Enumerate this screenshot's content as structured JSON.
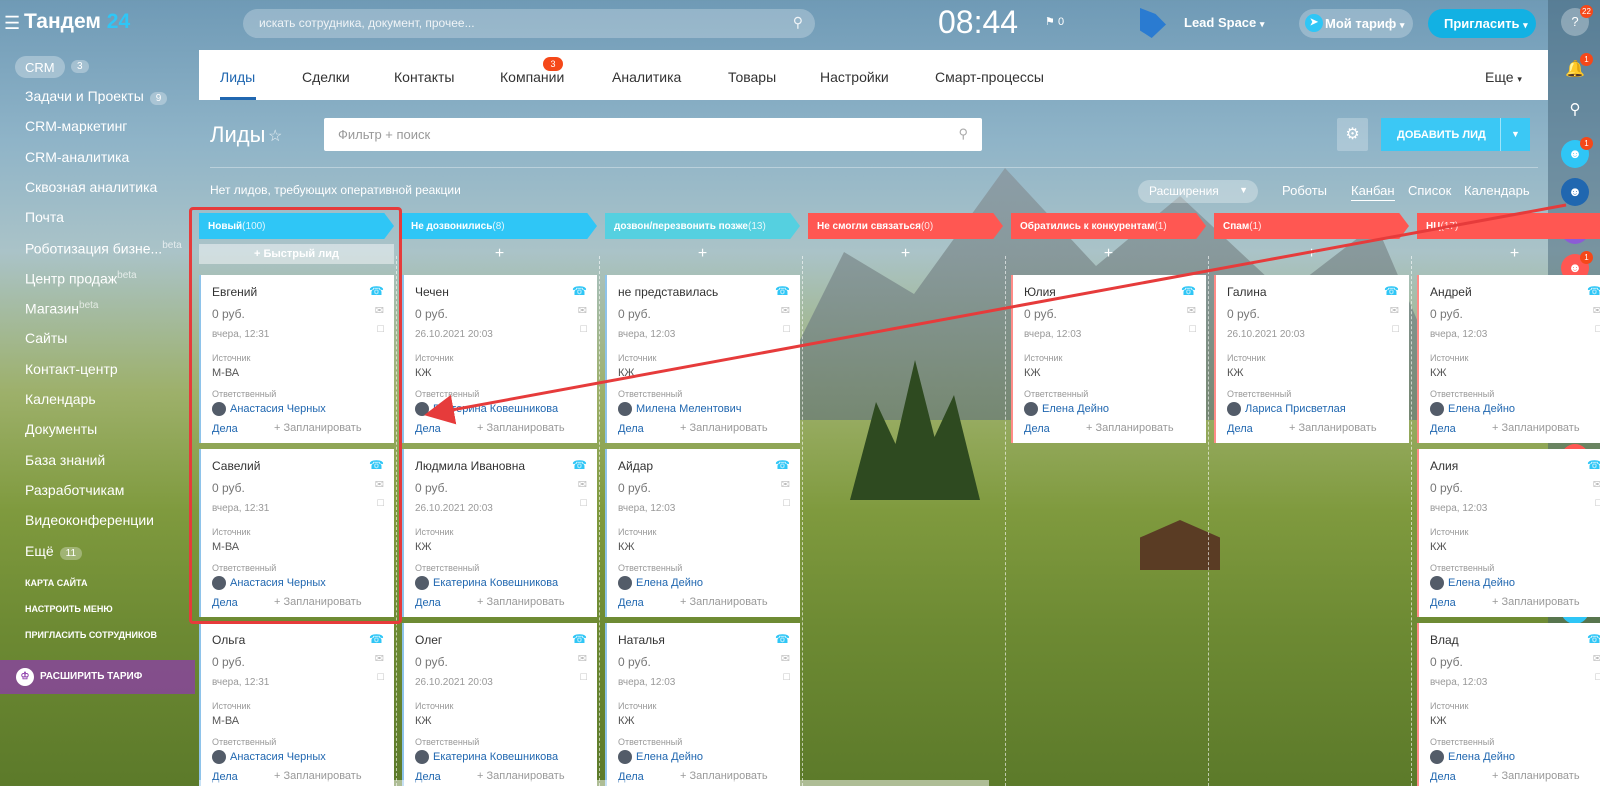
{
  "topbar": {
    "logo_main": "Тандем",
    "logo_num": "24",
    "search_placeholder": "искать сотрудника, документ, прочее...",
    "clock": "08:44",
    "flag_count": "0",
    "workspace": "Lead Space",
    "tariff": "Мой тариф",
    "invite": "Пригласить"
  },
  "rightbar": {
    "help_badge": "22",
    "items": [
      {
        "badge": "1"
      },
      {
        "badge": ""
      },
      {
        "badge": ""
      },
      {
        "badge": "1"
      },
      {
        "badge": "1"
      },
      {
        "badge": "1"
      },
      {
        "badge": "1"
      },
      {
        "badge": "1"
      },
      {
        "badge": ""
      },
      {
        "badge": ""
      },
      {
        "badge": "1"
      },
      {
        "badge": ""
      },
      {
        "badge": ""
      },
      {
        "badge": ""
      },
      {
        "badge": ""
      },
      {
        "badge": ""
      }
    ]
  },
  "sidebar": {
    "crm": "CRM",
    "crm_count": "3",
    "items": [
      {
        "label": "Задачи и Проекты",
        "count": "9"
      },
      {
        "label": "CRM-маркетинг"
      },
      {
        "label": "CRM-аналитика"
      },
      {
        "label": "Сквозная аналитика"
      },
      {
        "label": "Почта"
      },
      {
        "label": "Роботизация бизне...",
        "beta": "beta"
      },
      {
        "label": "Центр продаж",
        "beta": "beta"
      },
      {
        "label": "Магазин",
        "beta": "beta"
      },
      {
        "label": "Сайты"
      },
      {
        "label": "Контакт-центр"
      },
      {
        "label": "Календарь"
      },
      {
        "label": "Документы"
      },
      {
        "label": "База знаний"
      },
      {
        "label": "Разработчикам"
      },
      {
        "label": "Видеоконференции"
      },
      {
        "label": "Ещё",
        "count": "11"
      }
    ],
    "site_map": "КАРТА САЙТА",
    "setup_menu": "НАСТРОИТЬ МЕНЮ",
    "invite_staff": "ПРИГЛАСИТЬ СОТРУДНИКОВ",
    "upgrade": "РАСШИРИТЬ ТАРИФ"
  },
  "tabs": {
    "items": [
      "Лиды",
      "Сделки",
      "Контакты",
      "Компании",
      "Аналитика",
      "Товары",
      "Настройки",
      "Смарт-процессы"
    ],
    "deals_badge": "3",
    "more": "Еще"
  },
  "page": {
    "title": "Лиды",
    "filter_placeholder": "Фильтр + поиск",
    "add_lead": "ДОБАВИТЬ ЛИД",
    "notice": "Нет лидов, требующих оперативной реакции",
    "extensions": "Расширения",
    "views": [
      "Роботы",
      "Канбан",
      "Список",
      "Календарь"
    ]
  },
  "labels": {
    "source": "Источник",
    "responsible": "Ответственный",
    "deals": "Дела",
    "plan": "+ Запланировать",
    "quick_lead": "Быстрый лид",
    "add": "+"
  },
  "columns": [
    {
      "title": "Новый",
      "count": "(100)",
      "color": "#2fc6f6",
      "cards": [
        {
          "name": "Евгений",
          "sum": "0 руб.",
          "date": "вчера, 12:31",
          "source": "М-ВА",
          "resp": "Анастасия Черных"
        },
        {
          "name": "Савелий",
          "sum": "0 руб.",
          "date": "вчера, 12:31",
          "source": "М-ВА",
          "resp": "Анастасия Черных"
        },
        {
          "name": "Ольга",
          "sum": "0 руб.",
          "date": "вчера, 12:31",
          "source": "М-ВА",
          "resp": "Анастасия Черных"
        }
      ]
    },
    {
      "title": "Не дозвонились",
      "count": "(8)",
      "color": "#2fc6f6",
      "cards": [
        {
          "name": "Чечен",
          "sum": "0 руб.",
          "date": "26.10.2021 20:03",
          "source": "КЖ",
          "resp": "Екатерина Ковешникова"
        },
        {
          "name": "Людмила Ивановна",
          "sum": "0 руб.",
          "date": "26.10.2021 20:03",
          "source": "КЖ",
          "resp": "Екатерина Ковешникова"
        },
        {
          "name": "Олег",
          "sum": "0 руб.",
          "date": "26.10.2021 20:03",
          "source": "КЖ",
          "resp": "Екатерина Ковешникова"
        }
      ]
    },
    {
      "title": "дозвон/перезвонить позже",
      "count": "(13)",
      "color": "#55d0e0",
      "cards": [
        {
          "name": "не представилась",
          "sum": "0 руб.",
          "date": "вчера, 12:03",
          "source": "КЖ",
          "resp": "Милена Мелентович"
        },
        {
          "name": "Айдар",
          "sum": "0 руб.",
          "date": "вчера, 12:03",
          "source": "КЖ",
          "resp": "Елена Дейно"
        },
        {
          "name": "Наталья",
          "sum": "0 руб.",
          "date": "вчера, 12:03",
          "source": "КЖ",
          "resp": "Елена Дейно"
        }
      ]
    },
    {
      "title": "Не смогли связаться",
      "count": "(0)",
      "color": "#ff5752",
      "cards": []
    },
    {
      "title": "Обратились к конкурентам",
      "count": "(1)",
      "color": "#ff5752",
      "cards": [
        {
          "name": "Юлия",
          "sum": "0 руб.",
          "date": "вчера, 12:03",
          "source": "КЖ",
          "resp": "Елена Дейно"
        }
      ]
    },
    {
      "title": "Спам",
      "count": "(1)",
      "color": "#ff5752",
      "cards": [
        {
          "name": "Галина",
          "sum": "0 руб.",
          "date": "26.10.2021 20:03",
          "source": "КЖ",
          "resp": "Лариса Присветлая"
        }
      ]
    },
    {
      "title": "НЦ",
      "count": "(17)",
      "color": "#ff5752",
      "cards": [
        {
          "name": "Андрей",
          "sum": "0 руб.",
          "date": "вчера, 12:03",
          "source": "КЖ",
          "resp": "Елена Дейно"
        },
        {
          "name": "Алия",
          "sum": "0 руб.",
          "date": "вчера, 12:03",
          "source": "КЖ",
          "resp": "Елена Дейно"
        },
        {
          "name": "Влад",
          "sum": "0 руб.",
          "date": "вчера, 12:03",
          "source": "КЖ",
          "resp": "Елена Дейно"
        }
      ]
    }
  ]
}
